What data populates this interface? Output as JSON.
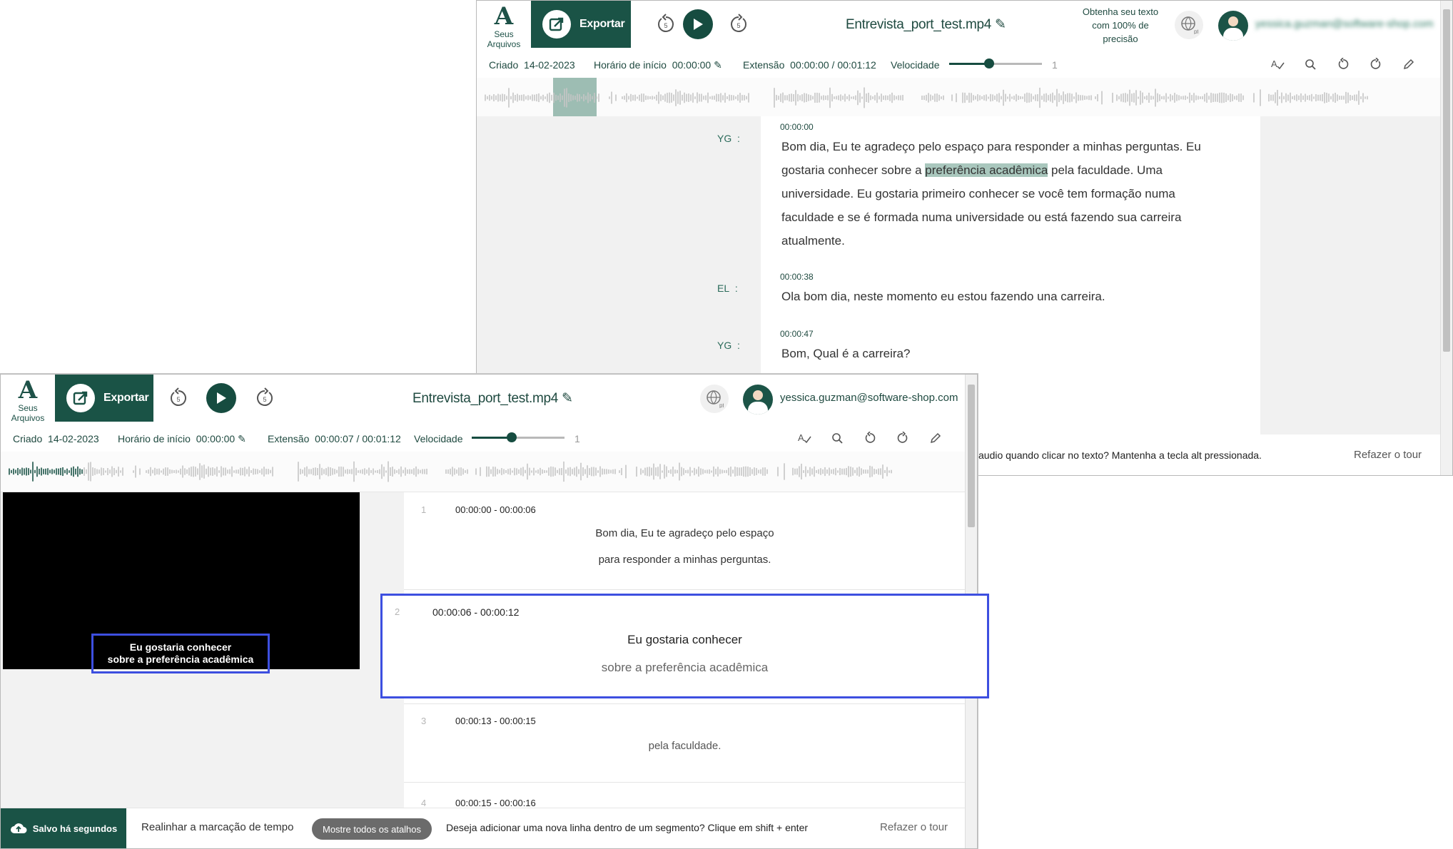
{
  "back": {
    "logo_label": "Seus Arquivos",
    "export_label": "Exportar",
    "rewind_label": "5",
    "forward_label": "5",
    "file_name": "Entrevista_port_test.mp4",
    "promo": "Obtenha seu texto com 100% de precisão",
    "lang_code": "pt",
    "email": "yessica.guzman@software-shop.com",
    "info": {
      "created_label": "Criado",
      "created_value": "14-02-2023",
      "start_label": "Horário de início",
      "start_value": "00:00:00",
      "length_label": "Extensão",
      "length_value": "00:00:00 / 00:01:12",
      "speed_label": "Velocidade",
      "speed_value": "1"
    },
    "transcript": [
      {
        "speaker": "YG",
        "time": "00:00:00",
        "pre": "Bom dia, Eu te agradeço pelo espaço para responder a minhas perguntas. Eu gostaria conhecer sobre a ",
        "highlight": "preferência acadêmica",
        "post": " pela faculdade. Uma universidade. Eu gostaria primeiro conhecer se você tem formação numa faculdade e se é formada numa universidade ou está fazendo sua carreira atualmente."
      },
      {
        "speaker": "EL",
        "time": "00:00:38",
        "text": "Ola bom dia, neste momento eu estou fazendo una carreira."
      },
      {
        "speaker": "YG",
        "time": "00:00:47",
        "text": "Bom, Qual é a carreira?"
      }
    ],
    "tip": "audio quando clicar no texto? Mantenha a tecla alt pressionada.",
    "redo_tour": "Refazer o tour"
  },
  "front": {
    "logo_label": "Seus Arquivos",
    "export_label": "Exportar",
    "rewind_label": "5",
    "forward_label": "5",
    "file_name": "Entrevista_port_test.mp4",
    "lang_code": "pt",
    "email": "yessica.guzman@software-shop.com",
    "info": {
      "created_label": "Criado",
      "created_value": "14-02-2023",
      "start_label": "Horário de início",
      "start_value": "00:00:00",
      "length_label": "Extensão",
      "length_value": "00:00:07 / 00:01:12",
      "speed_label": "Velocidade",
      "speed_value": "1"
    },
    "caption": {
      "line1": "Eu gostaria conhecer",
      "line2": "sobre a preferência acadêmica"
    },
    "segments": [
      {
        "num": "1",
        "time": "00:00:00 - 00:00:06",
        "line1": "Bom dia, Eu te agradeço pelo espaço",
        "line2": "para responder a minhas perguntas."
      },
      {
        "num": "2",
        "time": "00:00:06 - 00:00:12",
        "line1": "Eu gostaria conhecer",
        "line2": "sobre a preferência acadêmica"
      },
      {
        "num": "3",
        "time": "00:00:13 - 00:00:15",
        "line1": "pela faculdade."
      },
      {
        "num": "4",
        "time": "00:00:15 - 00:00:16"
      }
    ],
    "footer": {
      "saved": "Salvo há segundos",
      "realign": "Realinhar a marcação de tempo",
      "shortcuts": "Mostre todos os atalhos",
      "hint": "Deseja adicionar uma nova linha dentro de um segmento? Clique em shift + enter",
      "redo_tour": "Refazer o tour"
    }
  },
  "colors": {
    "brand": "#1a5346",
    "highlight": "#a9c7bd",
    "selection": "#3d4fe0"
  }
}
